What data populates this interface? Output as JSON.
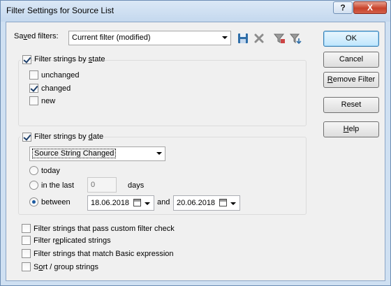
{
  "window": {
    "title": "Filter Settings for Source List",
    "help_label": "?",
    "close_label": "X"
  },
  "saved_filters": {
    "label_pre": "Sa",
    "label_u": "v",
    "label_post": "ed filters:",
    "selected": "Current filter (modified)",
    "icons": [
      "save-icon",
      "delete-icon",
      "filter-settings-icon",
      "filter-apply-icon"
    ]
  },
  "buttons": {
    "ok": "OK",
    "cancel": "Cancel",
    "remove_filter_u": "R",
    "remove_filter_rest": "emove Filter",
    "reset": "Reset",
    "help_u": "H",
    "help_rest": "elp"
  },
  "by_state": {
    "label_pre": "Filter strings by ",
    "label_u": "s",
    "label_post": "tate",
    "checked": true,
    "options": [
      {
        "label": "unchanged",
        "checked": false
      },
      {
        "label": "changed",
        "checked": true
      },
      {
        "label": "new",
        "checked": false
      }
    ]
  },
  "by_date": {
    "label_pre": "Filter strings by ",
    "label_u": "d",
    "label_post": "ate",
    "checked": true,
    "date_type": "Source String Changed",
    "today_label": "today",
    "in_last_label": "in the last",
    "days_value": "0",
    "days_label": "days",
    "between_label": "between",
    "date_from": "18.06.2018",
    "and_label": "and",
    "date_to": "20.06.2018",
    "selected_option": "between"
  },
  "extra_options": [
    {
      "label_pre": "Filter strings that pass custom filter check",
      "label_u": "",
      "label_post": "",
      "checked": false
    },
    {
      "label_pre": "Filter r",
      "label_u": "e",
      "label_post": "plicated strings",
      "checked": false
    },
    {
      "label_pre": "Filter strings that match Basic expression",
      "label_u": "",
      "label_post": "",
      "checked": false
    },
    {
      "label_pre": "S",
      "label_u": "o",
      "label_post": "rt / group strings",
      "checked": false
    }
  ]
}
